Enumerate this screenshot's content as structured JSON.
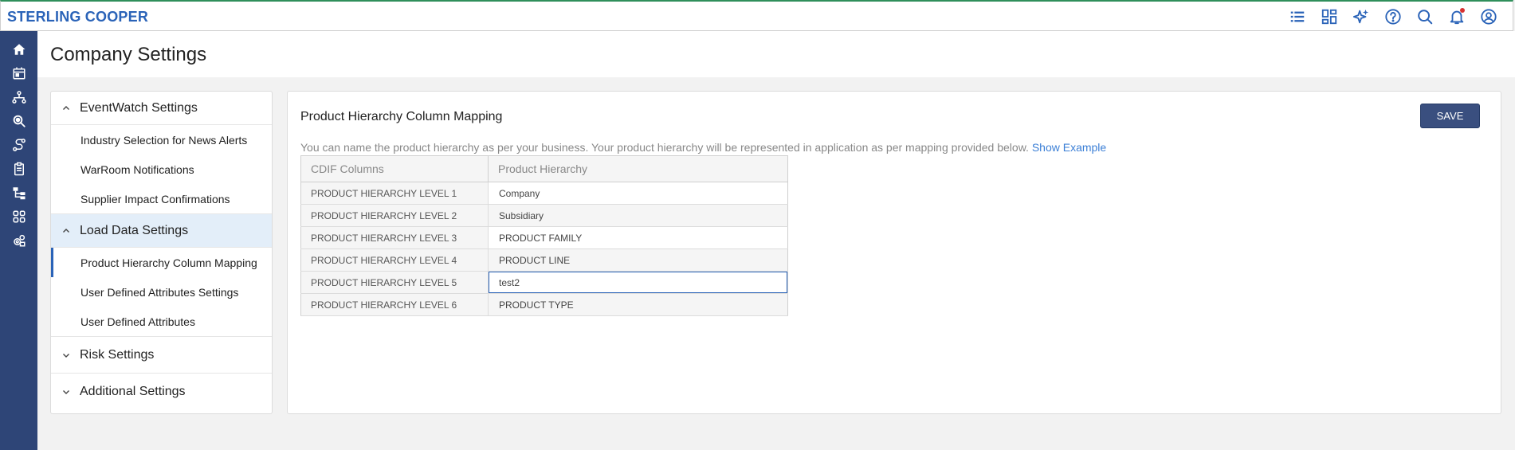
{
  "app": {
    "brand": "STERLING COOPER"
  },
  "page": {
    "title": "Company Settings"
  },
  "top_icons": [
    "list-icon",
    "dashboard-icon",
    "sparkle-icon",
    "help-icon",
    "search-icon",
    "bell-icon",
    "user-icon"
  ],
  "rail_icons": [
    "home-icon",
    "calendar-icon",
    "network-icon",
    "search-zoom-icon",
    "route-icon",
    "clipboard-icon",
    "hierarchy-icon",
    "apps-icon",
    "gear-cluster-icon"
  ],
  "nav": {
    "sections": [
      {
        "label": "EventWatch Settings",
        "expanded": true,
        "items": [
          "Industry Selection for News Alerts",
          "WarRoom Notifications",
          "Supplier Impact Confirmations"
        ]
      },
      {
        "label": "Load Data Settings",
        "expanded": true,
        "active": true,
        "items": [
          "Product Hierarchy Column Mapping",
          "User Defined Attributes Settings",
          "User Defined Attributes"
        ],
        "selected_item": "Product Hierarchy Column Mapping"
      },
      {
        "label": "Risk Settings",
        "expanded": false,
        "items": []
      },
      {
        "label": "Additional Settings",
        "expanded": false,
        "items": []
      }
    ]
  },
  "panel": {
    "title": "Product Hierarchy Column Mapping",
    "save_label": "SAVE",
    "description": "You can name the product hierarchy as per your business. Your product hierarchy will be represented in application as per mapping provided below.",
    "show_example": "Show Example",
    "table": {
      "headers": [
        "CDIF Columns",
        "Product Hierarchy"
      ],
      "rows": [
        {
          "level": "PRODUCT HIERARCHY LEVEL 1",
          "value": "Company"
        },
        {
          "level": "PRODUCT HIERARCHY LEVEL 2",
          "value": "Subsidiary"
        },
        {
          "level": "PRODUCT HIERARCHY LEVEL 3",
          "value": "PRODUCT FAMILY"
        },
        {
          "level": "PRODUCT HIERARCHY LEVEL 4",
          "value": "PRODUCT LINE"
        },
        {
          "level": "PRODUCT HIERARCHY LEVEL 5",
          "value": "test2",
          "focused": true
        },
        {
          "level": "PRODUCT HIERARCHY LEVEL 6",
          "value": "PRODUCT TYPE"
        }
      ]
    }
  },
  "colors": {
    "brand": "#2a63b8",
    "rail": "#2e4577",
    "save_button": "#3a4f7f",
    "active_section": "#e3eef9",
    "notification_dot": "#d63131"
  }
}
